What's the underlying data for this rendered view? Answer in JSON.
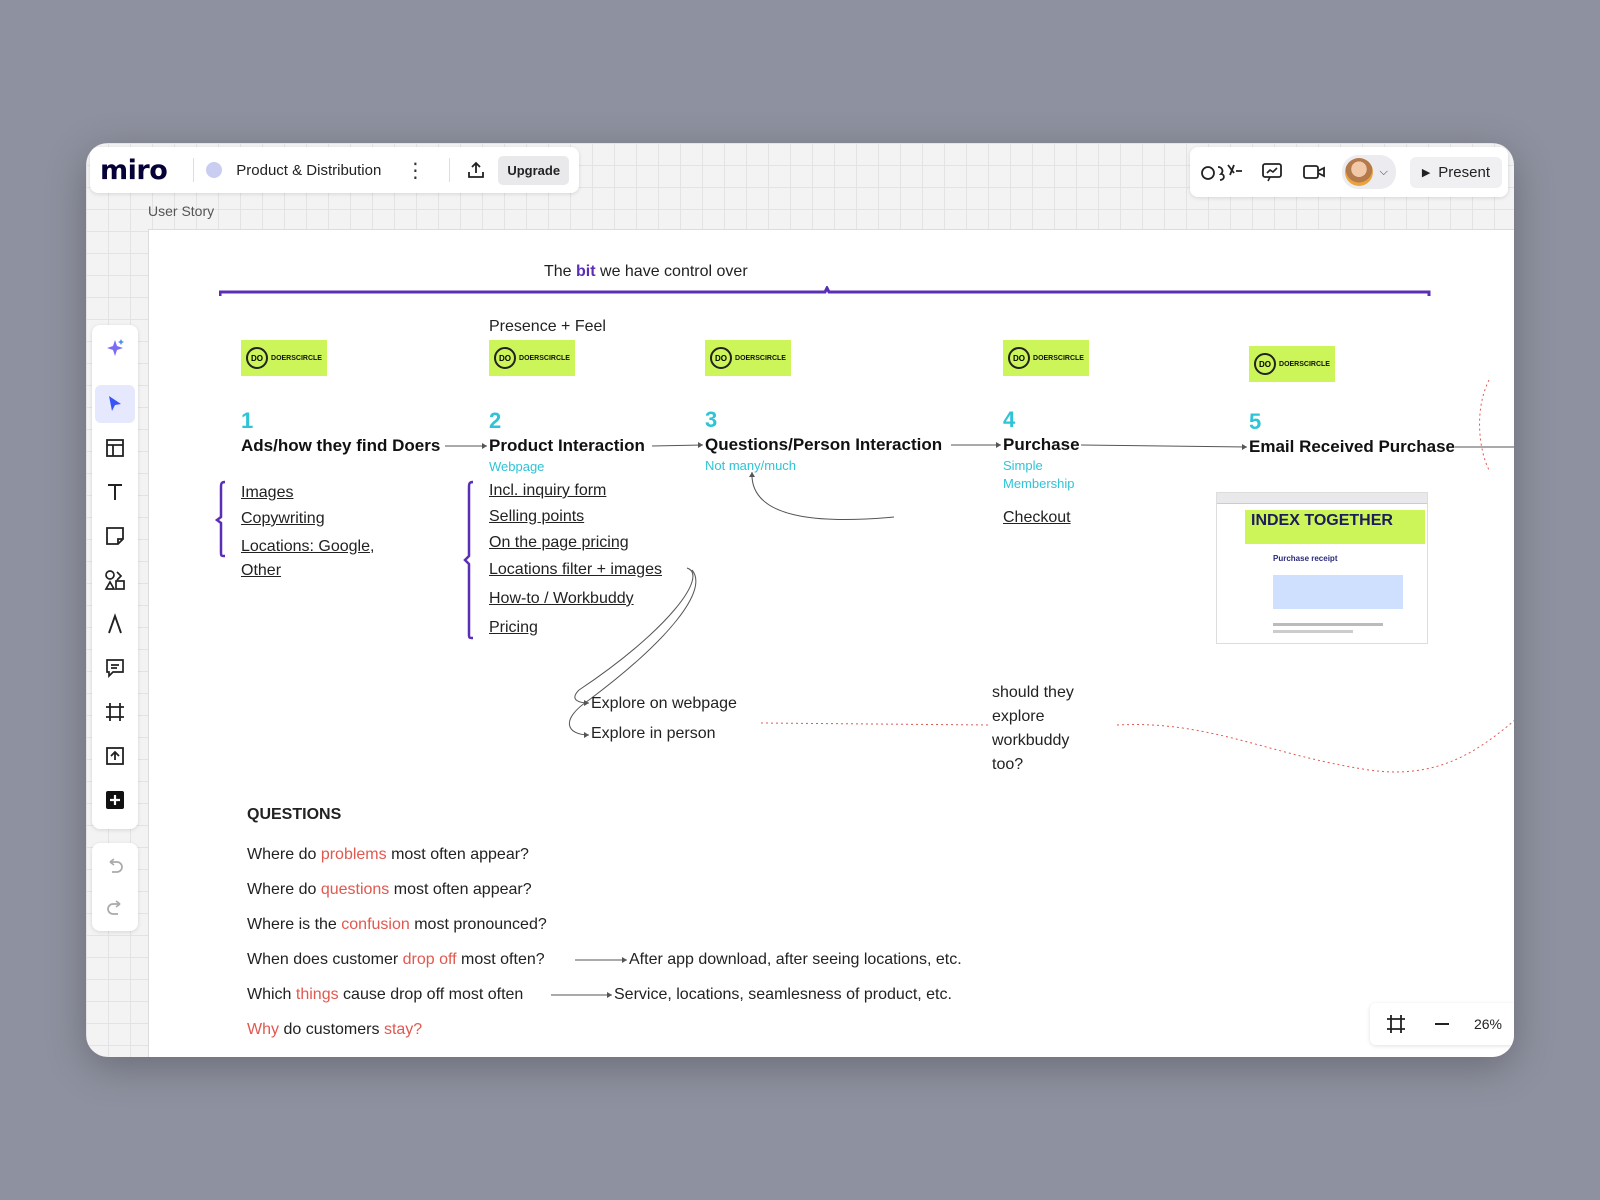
{
  "app": {
    "logo": "miro",
    "board_name": "Product & Distribution",
    "upgrade": "Upgrade",
    "present": "Present",
    "zoom": "26%"
  },
  "frame": {
    "label": "User Story"
  },
  "banner": {
    "pre": "The ",
    "bold": "bit",
    "post": " we have control over"
  },
  "presence": "Presence + Feel",
  "sticker_text": "DOERSCIRCLE",
  "sticker_mark": "DO",
  "steps": [
    {
      "num": "1",
      "title": "Ads/how they find Doers"
    },
    {
      "num": "2",
      "title": "Product Interaction",
      "sub": "Webpage"
    },
    {
      "num": "3",
      "title": "Questions/Person Interaction",
      "sub": "Not many/much"
    },
    {
      "num": "4",
      "title": "Purchase",
      "sub1": "Simple",
      "sub2": "Membership"
    },
    {
      "num": "5",
      "title": "Email Received Purchase"
    }
  ],
  "step1_items": [
    "Images",
    "Copywriting",
    "Locations: Google,",
    "Other"
  ],
  "step2_items": [
    "Incl. inquiry form",
    "Selling points",
    "On the page pricing",
    "Locations filter + images",
    "How-to / Workbuddy",
    "Pricing"
  ],
  "step4_items": [
    "Checkout"
  ],
  "explore": [
    "Explore on webpage",
    "Explore in person"
  ],
  "note": [
    "should they",
    "explore",
    "workbuddy",
    "too?"
  ],
  "receipt": {
    "banner": "INDEX TOGETHER",
    "heading": "Purchase receipt"
  },
  "questions": {
    "title": "QUESTIONS",
    "rows": [
      {
        "a": "Where do ",
        "r": "problems",
        "b": " most often appear?"
      },
      {
        "a": "Where do ",
        "r": "questions",
        "b": " most often appear?"
      },
      {
        "a": "Where is the ",
        "r": "confusion",
        "b": " most pronounced?"
      },
      {
        "a": "When does customer ",
        "r": "drop off",
        "b": " most often?",
        "ans": "After app download, after seeing locations, etc."
      },
      {
        "a": "Which ",
        "r": "things",
        "b": " cause drop off most often",
        "ans": "Service, locations, seamlesness of product, etc."
      }
    ],
    "last": {
      "r1": "Why",
      "mid": " do customers ",
      "r2": "stay?"
    }
  },
  "colors": {
    "accent": "#5b2fb5",
    "cyan": "#2ec4d6",
    "lime": "#ccf55a",
    "red": "#e1584f"
  },
  "icons": [
    "ai-sparkle-icon",
    "cursor-icon",
    "templates-icon",
    "text-icon",
    "sticky-note-icon",
    "shapes-icon",
    "pen-icon",
    "comment-icon",
    "frame-icon",
    "upload-icon",
    "add-icon",
    "undo-icon",
    "redo-icon",
    "share-icon",
    "reactions-icon",
    "chat-icon",
    "video-icon",
    "present-icon",
    "fit-frame-icon",
    "zoom-out-icon"
  ]
}
